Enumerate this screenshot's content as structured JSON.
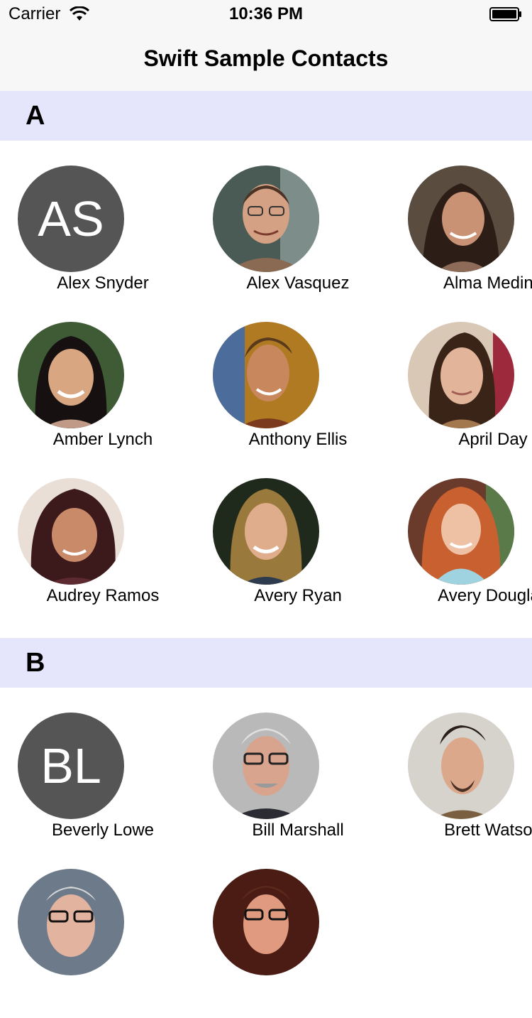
{
  "status_bar": {
    "carrier": "Carrier",
    "time": "10:36 PM"
  },
  "nav": {
    "title": "Swift Sample Contacts"
  },
  "sections": [
    {
      "letter": "A",
      "contacts": [
        {
          "name": "Alex Snyder",
          "initials": "AS"
        },
        {
          "name": "Alex Vasquez"
        },
        {
          "name": "Alma Medina"
        },
        {
          "name": "Amber Lynch"
        },
        {
          "name": "Anthony Ellis"
        },
        {
          "name": "April Day"
        },
        {
          "name": "Audrey Ramos"
        },
        {
          "name": "Avery Ryan"
        },
        {
          "name": "Avery Douglas"
        }
      ]
    },
    {
      "letter": "B",
      "contacts": [
        {
          "name": "Beverly Lowe",
          "initials": "BL"
        },
        {
          "name": "Bill Marshall"
        },
        {
          "name": "Brett Watson"
        },
        {
          "name": ""
        },
        {
          "name": ""
        }
      ]
    }
  ],
  "colors": {
    "section_header_bg": "#e5e5fb",
    "initials_avatar_bg": "#555555",
    "bar_bg": "#f7f7f7"
  }
}
